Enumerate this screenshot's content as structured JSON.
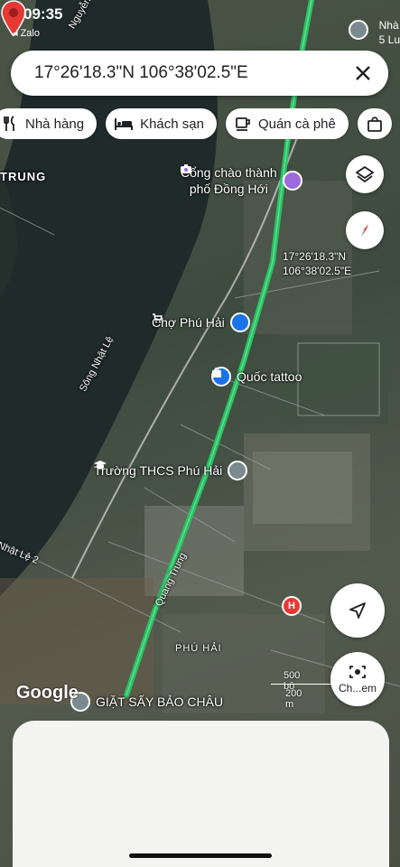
{
  "status_bar": {
    "time": "09:35",
    "back_app": "◂ Zalo",
    "right_partial": "Nhà\n5 Lu"
  },
  "search": {
    "value": "17°26'18.3\"N 106°38'02.5\"E",
    "close_icon": "close-icon"
  },
  "chips": [
    {
      "label": "Nhà hàng",
      "icon": "restaurant-icon"
    },
    {
      "label": "Khách sạn",
      "icon": "hotel-icon"
    },
    {
      "label": "Quán cà phê",
      "icon": "coffee-icon"
    },
    {
      "label": "",
      "icon": "shopping-bag-icon"
    }
  ],
  "map": {
    "labels": {
      "trung_top": "TRUNG",
      "nguyen_trai": "Nguyễn Trã",
      "song_nhat_le": "Sông Nhật Lệ",
      "nhat_le_2": "Nhật Lệ 2",
      "quang_trung": "Quang Trung",
      "phu_hai": "PHÚ HẢI",
      "ru_partial": "ru"
    },
    "pois": {
      "cong_chao": "Cổng chào thành\nphố Đồng Hới",
      "cho_phu_hai": "Chợ Phú Hải",
      "quoc_tattoo": "Quốc tattoo",
      "truong_thcs": "Trường THCS Phú Hải",
      "giat_say": "GIẶT SẤY BẢO CHÂU"
    },
    "pin_label": "17°26'18.3\"N\n106°38'02.5\"E",
    "scale_top": "500 bộ",
    "scale_bottom": "200 m",
    "logo": "Google"
  },
  "buttons": {
    "lens_label": "Ch...em"
  },
  "colors": {
    "road_highlight": "#22c55e",
    "pin_red": "#e53935",
    "poi_blue": "#1a73e8",
    "poi_purple": "#9c6ade",
    "hospital_red": "#e53935"
  }
}
